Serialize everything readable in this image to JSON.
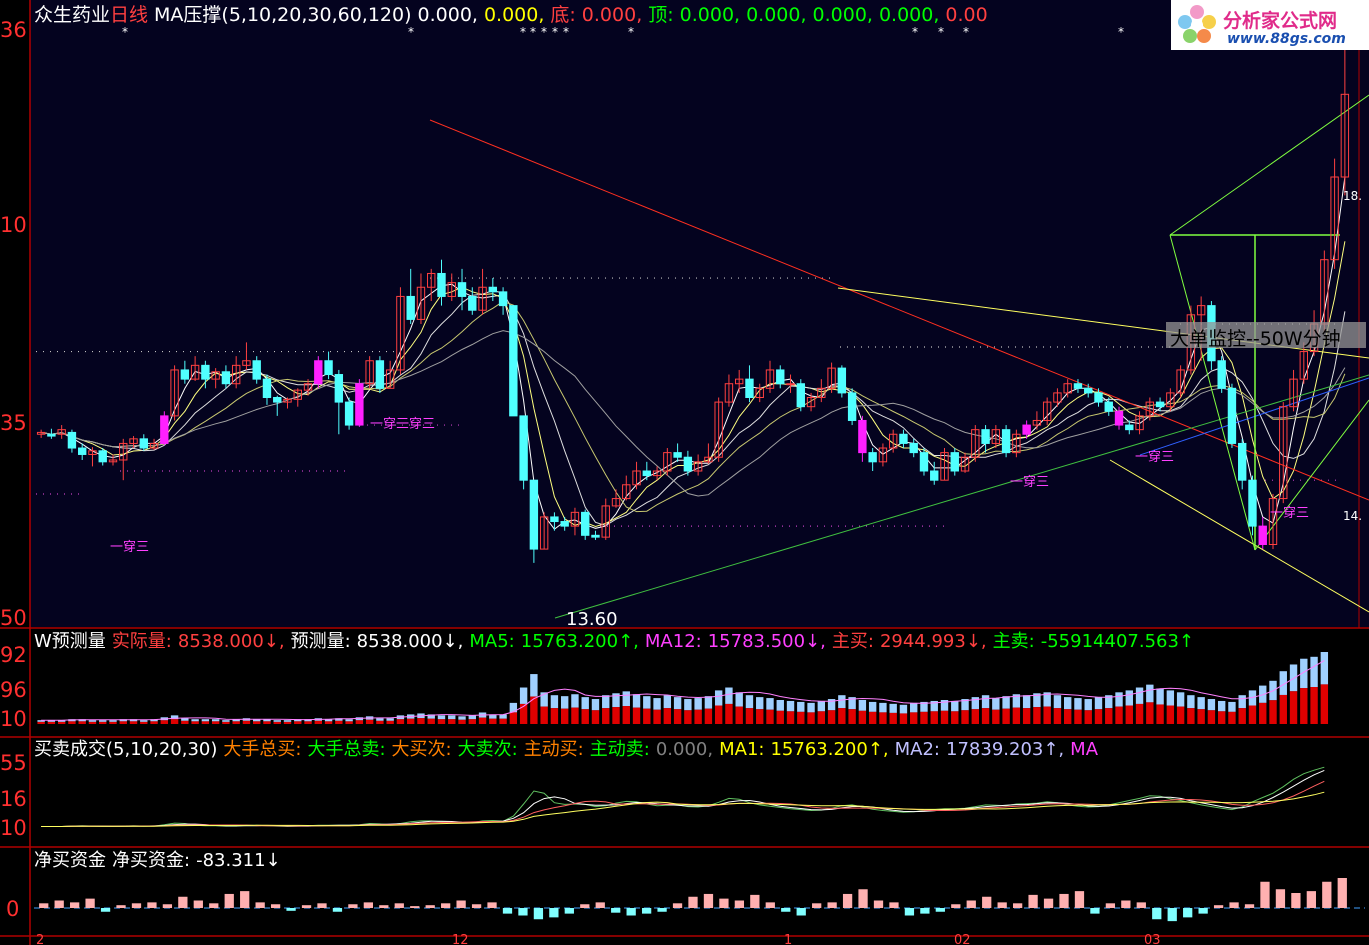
{
  "main_title": {
    "stock": "众生药业",
    "period": "日线",
    "indicator": "MA压撑(5,10,20,30,60,120)",
    "v1": "0.000,",
    "v2": "0.000,",
    "bottom_label": "底:",
    "bottom_value": "0.000,",
    "top_label": "顶:",
    "top_values": [
      "0.000,",
      "0.000,",
      "0.000,",
      "0.000,",
      "0.00"
    ]
  },
  "price_axis_labels": [
    "36",
    "10",
    "35",
    "50"
  ],
  "price_low_label": "13.60",
  "price_right_tags": [
    "18.",
    "14."
  ],
  "pattern_label": "一穿三",
  "overlay_text": "大单监控--50W分钟",
  "volume_panel": {
    "title": "W预测量",
    "items": [
      {
        "label": "实际量:",
        "value": "8538.000↓,",
        "color": "#ff4040"
      },
      {
        "label": "预测量:",
        "value": "8538.000↓,",
        "color": "#ffffff"
      },
      {
        "label": "MA5:",
        "value": "15763.200↑,",
        "color": "#00ff00"
      },
      {
        "label": "MA12:",
        "value": "15783.500↓,",
        "color": "#ff40ff"
      },
      {
        "label": "主买:",
        "value": "2944.993↓,",
        "color": "#ff4040"
      },
      {
        "label": "主卖:",
        "value": "-55914407.563↑",
        "color": "#00ff00"
      }
    ],
    "axis_labels": [
      "92",
      "96",
      "10"
    ]
  },
  "trade_panel": {
    "title": "买卖成交(5,10,20,30)",
    "items": [
      {
        "text": "大手总买:",
        "color": "#ff8000"
      },
      {
        "text": "大手总卖:",
        "color": "#00ff00"
      },
      {
        "text": "大买次:",
        "color": "#ff8000"
      },
      {
        "text": "大卖次:",
        "color": "#00ff00"
      },
      {
        "text": "主动买:",
        "color": "#ff8000"
      },
      {
        "text": "主动卖:",
        "color": "#00ff00"
      },
      {
        "text": "0.000,",
        "color": "#808080"
      },
      {
        "text": "MA1:",
        "color": "#ffff00"
      },
      {
        "text": "15763.200↑,",
        "color": "#ffff00"
      },
      {
        "text": "MA2:",
        "color": "#c0c0ff"
      },
      {
        "text": "17839.203↑,",
        "color": "#c0c0ff"
      },
      {
        "text": "MA",
        "color": "#ff40ff"
      }
    ],
    "axis_labels": [
      "55",
      "16",
      "10"
    ]
  },
  "net_panel": {
    "title": "净买资金",
    "label": "净买资金:",
    "value": "-83.311↓",
    "axis_labels": [
      "0"
    ]
  },
  "date_labels": [
    "2",
    "12",
    "1",
    "02",
    "03"
  ],
  "logo": {
    "line1": "分析家公式网",
    "line2": "www.88gs.com"
  },
  "chart_data": {
    "type": "candlestick",
    "price_axis": {
      "ylim": [
        13.0,
        19.4
      ],
      "ticks": [
        13.5,
        15.0,
        16.5,
        18.0
      ]
    },
    "low_marker": 13.6,
    "candles": [
      [
        15.0,
        15.02,
        15.05,
        14.96
      ],
      [
        15.0,
        14.98,
        15.06,
        14.95
      ],
      [
        15.0,
        15.05,
        15.1,
        14.95
      ],
      [
        15.02,
        14.85,
        15.05,
        14.8
      ],
      [
        14.85,
        14.78,
        14.9,
        14.72
      ],
      [
        14.78,
        14.82,
        14.86,
        14.65
      ],
      [
        14.82,
        14.7,
        14.85,
        14.66
      ],
      [
        14.7,
        14.72,
        14.78,
        14.66
      ],
      [
        14.72,
        14.9,
        14.95,
        14.5
      ],
      [
        14.9,
        14.95,
        14.98,
        14.85
      ],
      [
        14.95,
        14.85,
        15.0,
        14.82
      ],
      [
        14.85,
        14.9,
        14.95,
        14.83
      ],
      [
        14.9,
        15.2,
        15.25,
        14.88
      ],
      [
        15.2,
        15.7,
        15.75,
        15.15
      ],
      [
        15.7,
        15.6,
        15.8,
        15.55
      ],
      [
        15.6,
        15.75,
        15.85,
        15.58
      ],
      [
        15.75,
        15.6,
        15.8,
        15.5
      ],
      [
        15.6,
        15.68,
        15.72,
        15.5
      ],
      [
        15.68,
        15.55,
        15.75,
        15.5
      ],
      [
        15.55,
        15.75,
        15.85,
        15.5
      ],
      [
        15.75,
        15.8,
        16.0,
        15.7
      ],
      [
        15.8,
        15.6,
        15.85,
        15.55
      ],
      [
        15.6,
        15.4,
        15.65,
        15.32
      ],
      [
        15.4,
        15.35,
        15.42,
        15.2
      ],
      [
        15.35,
        15.38,
        15.4,
        15.28
      ],
      [
        15.38,
        15.48,
        15.5,
        15.3
      ],
      [
        15.48,
        15.55,
        15.6,
        15.42
      ],
      [
        15.55,
        15.8,
        15.85,
        15.5
      ],
      [
        15.8,
        15.65,
        15.9,
        15.6
      ],
      [
        15.65,
        15.35,
        15.7,
        15.0
      ],
      [
        15.35,
        15.1,
        15.4,
        15.05
      ],
      [
        15.1,
        15.55,
        15.6,
        15.08
      ],
      [
        15.55,
        15.8,
        15.85,
        15.5
      ],
      [
        15.8,
        15.5,
        15.85,
        15.45
      ],
      [
        15.5,
        15.7,
        15.8,
        15.5
      ],
      [
        15.7,
        16.5,
        16.6,
        15.65
      ],
      [
        16.5,
        16.25,
        16.8,
        16.2
      ],
      [
        16.25,
        16.6,
        16.75,
        16.2
      ],
      [
        16.6,
        16.75,
        16.8,
        16.45
      ],
      [
        16.75,
        16.5,
        16.9,
        16.4
      ],
      [
        16.5,
        16.65,
        16.75,
        16.45
      ],
      [
        16.65,
        16.5,
        16.8,
        16.35
      ],
      [
        16.5,
        16.35,
        16.6,
        16.3
      ],
      [
        16.35,
        16.6,
        16.8,
        16.3
      ],
      [
        16.6,
        16.55,
        16.7,
        16.45
      ],
      [
        16.55,
        16.4,
        16.6,
        16.3
      ],
      [
        16.4,
        15.2,
        16.1,
        15.2
      ],
      [
        15.2,
        14.5,
        14.8,
        14.4
      ],
      [
        14.5,
        13.75,
        14.3,
        13.6
      ],
      [
        13.75,
        14.1,
        14.15,
        13.75
      ],
      [
        14.1,
        14.05,
        14.15,
        13.95
      ],
      [
        14.05,
        14.0,
        14.1,
        13.95
      ],
      [
        14.0,
        14.15,
        14.2,
        13.9
      ],
      [
        14.15,
        13.9,
        14.18,
        13.85
      ],
      [
        13.9,
        13.88,
        13.95,
        13.85
      ],
      [
        13.88,
        14.22,
        14.3,
        13.85
      ],
      [
        14.22,
        14.3,
        14.4,
        14.2
      ],
      [
        14.3,
        14.45,
        14.55,
        14.28
      ],
      [
        14.45,
        14.6,
        14.7,
        14.4
      ],
      [
        14.6,
        14.55,
        14.7,
        14.5
      ],
      [
        14.55,
        14.6,
        14.65,
        14.5
      ],
      [
        14.6,
        14.8,
        14.85,
        14.55
      ],
      [
        14.8,
        14.75,
        14.9,
        14.7
      ],
      [
        14.75,
        14.6,
        14.82,
        14.55
      ],
      [
        14.6,
        14.7,
        14.78,
        14.55
      ],
      [
        14.7,
        14.75,
        14.9,
        14.68
      ],
      [
        14.75,
        15.35,
        15.4,
        14.7
      ],
      [
        15.35,
        15.55,
        15.65,
        15.3
      ],
      [
        15.55,
        15.6,
        15.7,
        15.45
      ],
      [
        15.6,
        15.4,
        15.75,
        15.35
      ],
      [
        15.4,
        15.5,
        15.55,
        15.35
      ],
      [
        15.5,
        15.7,
        15.8,
        15.45
      ],
      [
        15.7,
        15.55,
        15.75,
        15.5
      ],
      [
        15.55,
        15.55,
        15.65,
        15.45
      ],
      [
        15.55,
        15.3,
        15.6,
        15.25
      ],
      [
        15.3,
        15.4,
        15.45,
        15.25
      ],
      [
        15.4,
        15.5,
        15.6,
        15.35
      ],
      [
        15.5,
        15.72,
        15.78,
        15.45
      ],
      [
        15.72,
        15.45,
        15.75,
        15.4
      ],
      [
        15.45,
        15.15,
        15.5,
        15.1
      ],
      [
        15.15,
        14.8,
        15.2,
        14.7
      ],
      [
        14.8,
        14.7,
        14.85,
        14.6
      ],
      [
        14.7,
        14.85,
        14.9,
        14.65
      ],
      [
        14.85,
        15.0,
        15.05,
        14.8
      ],
      [
        15.0,
        14.9,
        15.05,
        14.85
      ],
      [
        14.9,
        14.8,
        14.95,
        14.75
      ],
      [
        14.8,
        14.6,
        14.85,
        14.55
      ],
      [
        14.6,
        14.5,
        14.7,
        14.45
      ],
      [
        14.5,
        14.8,
        14.85,
        14.5
      ],
      [
        14.8,
        14.6,
        14.85,
        14.55
      ],
      [
        14.6,
        14.75,
        14.8,
        14.58
      ],
      [
        14.75,
        15.05,
        15.1,
        14.7
      ],
      [
        15.05,
        14.9,
        15.1,
        14.8
      ],
      [
        14.9,
        15.05,
        15.1,
        14.85
      ],
      [
        15.05,
        14.8,
        15.1,
        14.75
      ],
      [
        14.8,
        15.0,
        15.05,
        14.75
      ],
      [
        15.0,
        15.1,
        15.15,
        14.95
      ],
      [
        15.1,
        15.15,
        15.25,
        15.05
      ],
      [
        15.15,
        15.35,
        15.4,
        15.1
      ],
      [
        15.35,
        15.45,
        15.5,
        15.3
      ],
      [
        15.45,
        15.55,
        15.6,
        15.4
      ],
      [
        15.55,
        15.5,
        15.6,
        15.45
      ],
      [
        15.5,
        15.45,
        15.55,
        15.4
      ],
      [
        15.45,
        15.35,
        15.5,
        15.3
      ],
      [
        15.35,
        15.25,
        15.4,
        15.2
      ],
      [
        15.25,
        15.1,
        15.3,
        15.05
      ],
      [
        15.1,
        15.05,
        15.15,
        15.0
      ],
      [
        15.05,
        15.2,
        15.25,
        15.0
      ],
      [
        15.2,
        15.35,
        15.4,
        15.15
      ],
      [
        15.35,
        15.3,
        15.4,
        15.25
      ],
      [
        15.3,
        15.45,
        15.5,
        15.25
      ],
      [
        15.45,
        15.7,
        15.75,
        15.4
      ],
      [
        15.7,
        16.3,
        16.4,
        15.65
      ],
      [
        16.3,
        16.4,
        16.5,
        15.8
      ],
      [
        16.4,
        15.8,
        16.45,
        15.7
      ],
      [
        15.8,
        15.5,
        15.85,
        15.45
      ],
      [
        15.5,
        14.9,
        15.55,
        14.85
      ],
      [
        14.9,
        14.5,
        14.95,
        14.4
      ],
      [
        14.5,
        14.0,
        14.55,
        13.9
      ],
      [
        14.0,
        13.8,
        14.1,
        13.75
      ],
      [
        13.8,
        14.3,
        14.35,
        13.75
      ],
      [
        14.3,
        15.3,
        15.35,
        14.25
      ],
      [
        15.3,
        15.6,
        15.7,
        15.25
      ],
      [
        15.6,
        15.9,
        16.0,
        15.55
      ],
      [
        15.9,
        16.2,
        16.35,
        15.85
      ],
      [
        16.2,
        16.9,
        17.0,
        16.1
      ],
      [
        16.9,
        17.8,
        18.0,
        16.8
      ],
      [
        17.8,
        18.7,
        19.2,
        17.6
      ]
    ],
    "volume": [
      4,
      4,
      4,
      5,
      5,
      4,
      4,
      4,
      5,
      5,
      4,
      5,
      7,
      9,
      6,
      5,
      5,
      5,
      4,
      5,
      6,
      5,
      5,
      4,
      4,
      5,
      5,
      6,
      5,
      6,
      5,
      7,
      8,
      6,
      6,
      9,
      10,
      11,
      10,
      9,
      9,
      8,
      9,
      12,
      10,
      10,
      22,
      38,
      52,
      33,
      30,
      29,
      31,
      28,
      26,
      30,
      32,
      34,
      31,
      29,
      27,
      30,
      28,
      26,
      27,
      29,
      35,
      38,
      33,
      30,
      28,
      27,
      25,
      24,
      23,
      22,
      24,
      26,
      30,
      28,
      25,
      23,
      22,
      21,
      20,
      22,
      23,
      24,
      25,
      24,
      26,
      28,
      30,
      27,
      29,
      31,
      30,
      32,
      33,
      30,
      28,
      27,
      26,
      28,
      30,
      33,
      35,
      38,
      41,
      37,
      35,
      33,
      30,
      28,
      26,
      24,
      23,
      30,
      35,
      40,
      45,
      55,
      62,
      68,
      70,
      75
    ],
    "net": [
      0.5,
      0.8,
      0.6,
      1.0,
      -0.4,
      0.3,
      0.5,
      0.6,
      0.4,
      1.2,
      0.8,
      0.5,
      1.5,
      1.8,
      0.6,
      0.4,
      -0.3,
      0.3,
      0.5,
      -0.4,
      0.4,
      0.6,
      0.3,
      0.5,
      0.2,
      0.3,
      0.5,
      0.8,
      0.4,
      0.6,
      -0.6,
      -0.8,
      -1.2,
      -1.0,
      -0.6,
      0.4,
      0.6,
      -0.5,
      -0.8,
      -0.6,
      -0.4,
      0.5,
      1.2,
      1.5,
      1.0,
      0.8,
      1.4,
      0.6,
      -0.4,
      -0.8,
      0.5,
      0.6,
      1.5,
      2.0,
      0.8,
      0.6,
      -0.8,
      -0.6,
      -0.4,
      0.4,
      0.8,
      1.2,
      0.6,
      0.5,
      1.4,
      1.0,
      1.5,
      1.8,
      -0.6,
      0.5,
      0.8,
      0.6,
      -1.2,
      -1.4,
      -1.0,
      -0.6,
      0.3,
      0.6,
      0.4,
      2.8,
      2.0,
      1.6,
      1.8,
      2.8,
      3.2
    ]
  }
}
